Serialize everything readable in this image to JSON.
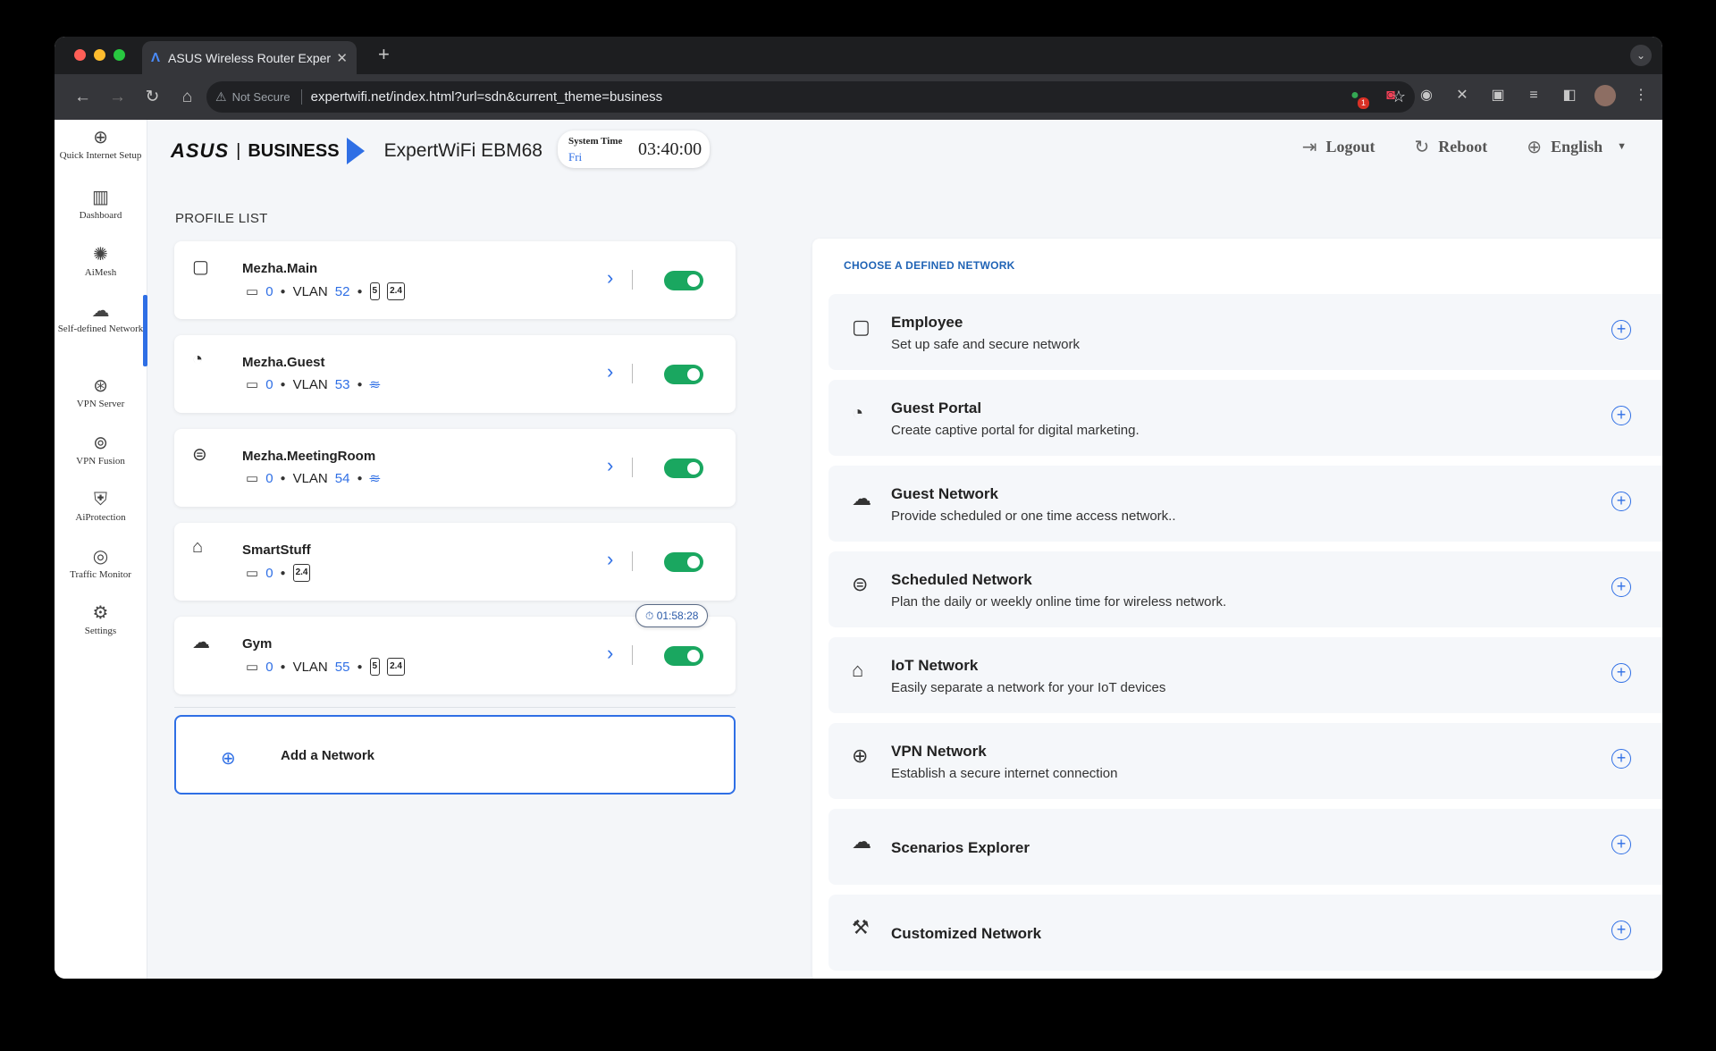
{
  "browser": {
    "tab_title": "ASUS Wireless Router Exper",
    "not_secure": "Not Secure",
    "url": "expertwifi.net/index.html?url=sdn&current_theme=business",
    "ext_badge": "1"
  },
  "sidebar": {
    "items": [
      {
        "label": "Quick Internet Setup",
        "icon": "globe-setup-icon"
      },
      {
        "label": "Dashboard",
        "icon": "bar-chart-icon"
      },
      {
        "label": "AiMesh",
        "icon": "mesh-icon"
      },
      {
        "label": "Self-defined Network",
        "icon": "network-icon"
      },
      {
        "label": "VPN Server",
        "icon": "vpn-server-icon"
      },
      {
        "label": "VPN Fusion",
        "icon": "vpn-fusion-icon"
      },
      {
        "label": "AiProtection",
        "icon": "shield-icon"
      },
      {
        "label": "Traffic Monitor",
        "icon": "traffic-icon"
      },
      {
        "label": "Settings",
        "icon": "gear-icon"
      }
    ],
    "active": "Self-defined Network"
  },
  "header": {
    "brand_asus": "ASUS",
    "brand_sep": "|",
    "brand_business": "BUSINESS",
    "model": "ExpertWiFi EBM68",
    "system_time_label": "System Time",
    "day": "Fri",
    "time": "03:40:00",
    "logout": "Logout",
    "reboot": "Reboot",
    "language": "English"
  },
  "profile_list": {
    "title": "PROFILE LIST",
    "profiles": [
      {
        "name": "Mezha.Main",
        "devices": "0",
        "vlan_label": "VLAN",
        "vlan": "52",
        "bands": [
          "5",
          "2.4"
        ],
        "enabled": true
      },
      {
        "name": "Mezha.Guest",
        "devices": "0",
        "vlan_label": "VLAN",
        "vlan": "53",
        "bands": [],
        "enabled": true
      },
      {
        "name": "Mezha.MeetingRoom",
        "devices": "0",
        "vlan_label": "VLAN",
        "vlan": "54",
        "bands": [],
        "enabled": true
      },
      {
        "name": "SmartStuff",
        "devices": "0",
        "bands": [
          "2.4"
        ],
        "enabled": true
      },
      {
        "name": "Gym",
        "devices": "0",
        "vlan_label": "VLAN",
        "vlan": "55",
        "bands": [
          "5",
          "2.4"
        ],
        "enabled": true,
        "timer": "01:58:28"
      }
    ],
    "add_label": "Add a Network"
  },
  "defined_networks": {
    "title": "CHOOSE A DEFINED NETWORK",
    "items": [
      {
        "title": "Employee",
        "desc": "Set up safe and secure network",
        "icon": "employee-icon"
      },
      {
        "title": "Guest Portal",
        "desc": "Create captive portal for digital marketing.",
        "icon": "guest-portal-icon"
      },
      {
        "title": "Guest Network",
        "desc": "Provide scheduled or one time access network..",
        "icon": "guest-network-icon"
      },
      {
        "title": "Scheduled Network",
        "desc": "Plan the daily or weekly online time for wireless network.",
        "icon": "scheduled-network-icon"
      },
      {
        "title": "IoT Network",
        "desc": "Easily separate a network for your IoT devices",
        "icon": "iot-icon"
      },
      {
        "title": "VPN Network",
        "desc": "Establish a secure internet connection",
        "icon": "vpn-network-icon"
      },
      {
        "title": "Scenarios Explorer",
        "desc": "",
        "icon": "scenarios-icon"
      },
      {
        "title": "Customized Network",
        "desc": "",
        "icon": "wrench-icon"
      }
    ]
  },
  "colors": {
    "accent": "#2f6fe5",
    "toggle_on": "#1aa760",
    "panel_title": "#1f63b5"
  }
}
